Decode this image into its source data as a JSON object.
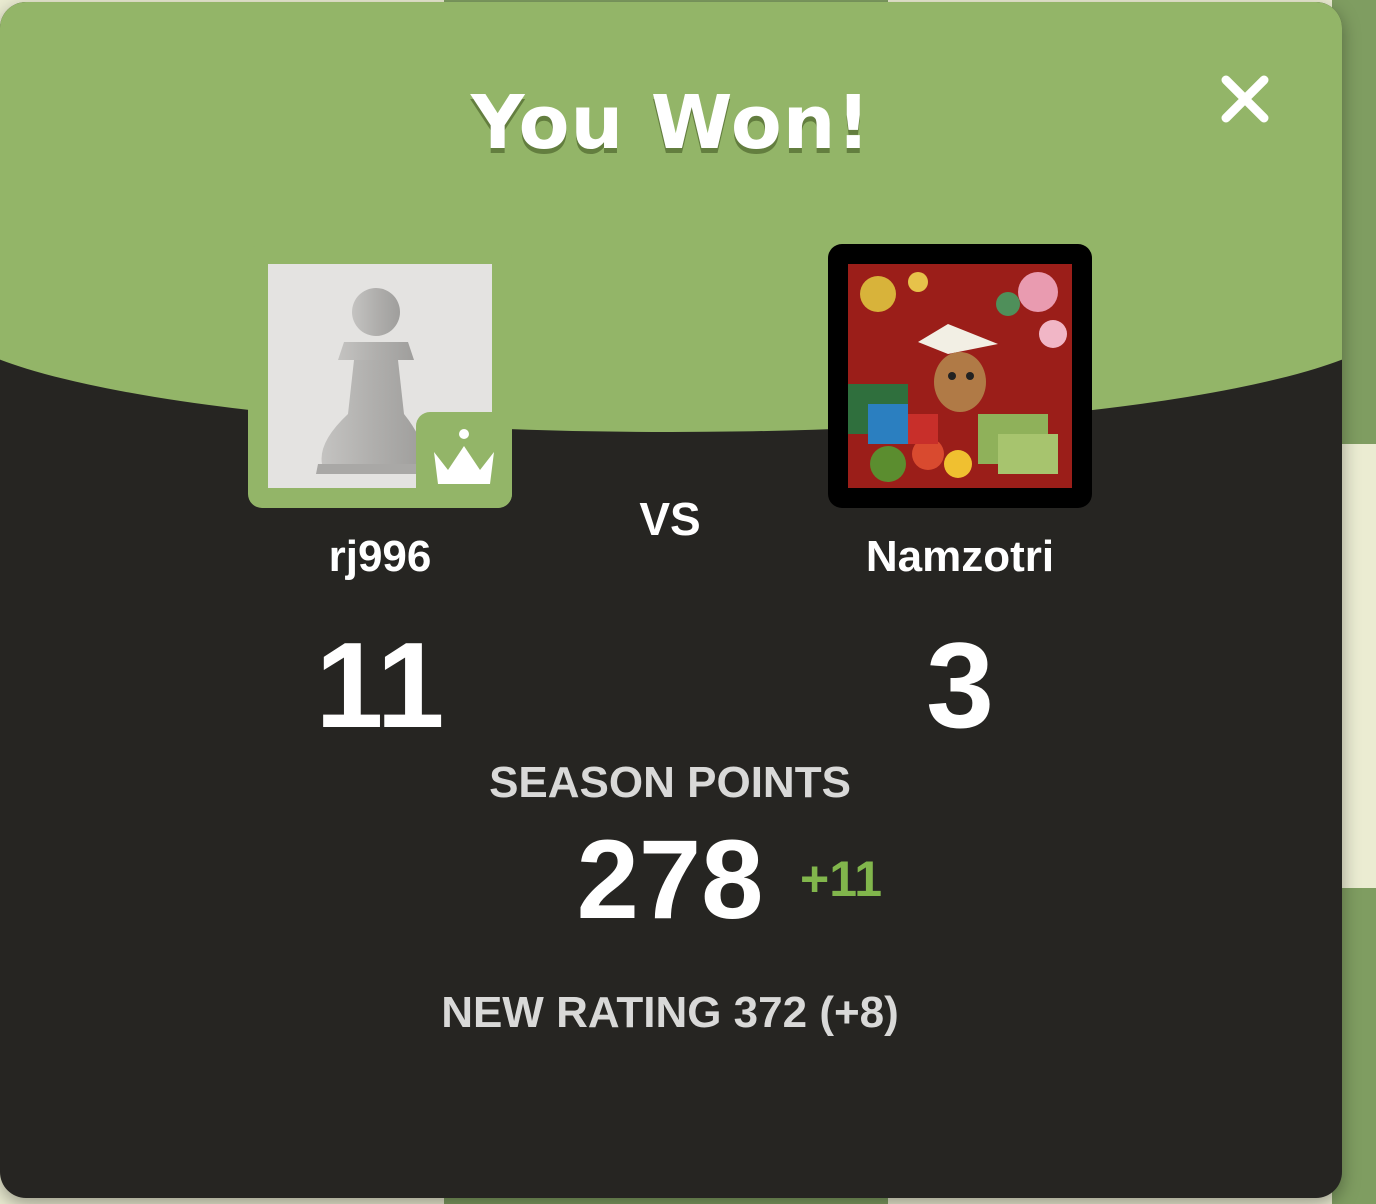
{
  "modal": {
    "title": "You Won!",
    "close_icon": "close-icon"
  },
  "players": {
    "left": {
      "username": "rj996",
      "score": "11",
      "avatar_icon": "pawn-icon",
      "badge_icon": "crown-icon"
    },
    "right": {
      "username": "Namzotri",
      "score": "3",
      "avatar_icon": "cat-photo-avatar"
    },
    "vs_label": "VS"
  },
  "season": {
    "label": "SEASON POINTS",
    "value": "278",
    "delta": "+11"
  },
  "rating": {
    "text": "NEW RATING 372 (+8)"
  },
  "colors": {
    "header_green": "#93b568",
    "dark_bg": "#262522",
    "positive_green": "#81b64c"
  }
}
